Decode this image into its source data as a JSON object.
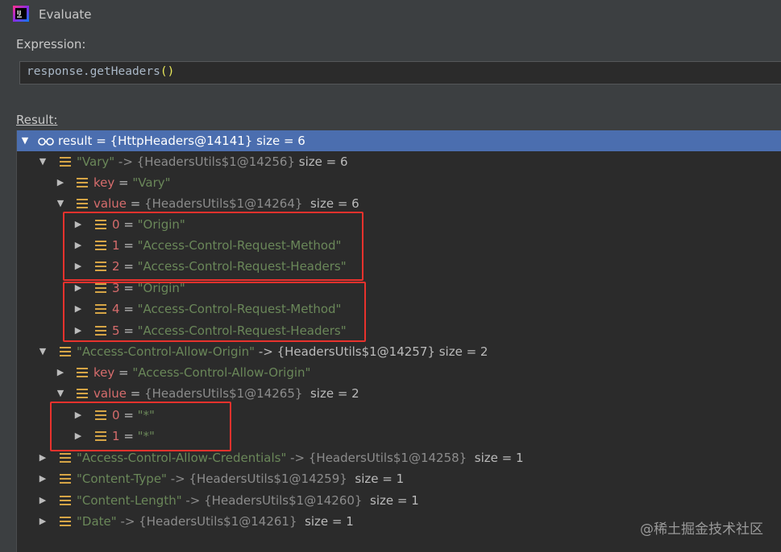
{
  "window": {
    "title": "Evaluate"
  },
  "expression": {
    "label": "Expression:",
    "code": "response.getHeaders",
    "parens": "()"
  },
  "result": {
    "label": "Result:"
  },
  "tree": [
    {
      "name": "root",
      "text": "result = {HttpHeaders@14141}  size = 6",
      "state": "expanded"
    },
    {
      "key": "\"Vary\"",
      "ref": "-> {HeadersUtils$1@14256}",
      "size": "size = 6",
      "state": "expanded"
    },
    {
      "label": "key",
      "eq": " = ",
      "val": "\"Vary\"",
      "state": "collapsed"
    },
    {
      "label": "value",
      "eq": " = ",
      "ref": "{HeadersUtils$1@14264}",
      "size": "size = 6",
      "state": "expanded"
    },
    {
      "idx": "0",
      "eq": " = ",
      "val": "\"Origin\"",
      "state": "collapsed"
    },
    {
      "idx": "1",
      "eq": " = ",
      "val": "\"Access-Control-Request-Method\"",
      "state": "collapsed"
    },
    {
      "idx": "2",
      "eq": " = ",
      "val": "\"Access-Control-Request-Headers\"",
      "state": "collapsed"
    },
    {
      "idx": "3",
      "eq": " = ",
      "val": "\"Origin\"",
      "state": "collapsed"
    },
    {
      "idx": "4",
      "eq": " = ",
      "val": "\"Access-Control-Request-Method\"",
      "state": "collapsed"
    },
    {
      "idx": "5",
      "eq": " = ",
      "val": "\"Access-Control-Request-Headers\"",
      "state": "collapsed"
    },
    {
      "key": "\"Access-Control-Allow-Origin\"",
      "ref": "-> {HeadersUtils$1@14257}",
      "size": "size = 2",
      "state": "expanded"
    },
    {
      "label": "key",
      "eq": " = ",
      "val": "\"Access-Control-Allow-Origin\"",
      "state": "collapsed"
    },
    {
      "label": "value",
      "eq": " = ",
      "ref": "{HeadersUtils$1@14265}",
      "size": "size = 2",
      "state": "expanded"
    },
    {
      "idx": "0",
      "eq": " = ",
      "val": "\"*\"",
      "state": "collapsed"
    },
    {
      "idx": "1",
      "eq": " = ",
      "val": "\"*\"",
      "state": "collapsed"
    },
    {
      "key": "\"Access-Control-Allow-Credentials\"",
      "ref": "-> {HeadersUtils$1@14258}",
      "size": "size = 1",
      "state": "collapsed"
    },
    {
      "key": "\"Content-Type\"",
      "ref": "-> {HeadersUtils$1@14259}",
      "size": "size = 1",
      "state": "collapsed"
    },
    {
      "key": "\"Content-Length\"",
      "ref": "-> {HeadersUtils$1@14260}",
      "size": "size = 1",
      "state": "collapsed"
    },
    {
      "key": "\"Date\"",
      "ref": "-> {HeadersUtils$1@14261}",
      "size": "size = 1",
      "state": "collapsed"
    }
  ],
  "watermark": "@稀土掘金技术社区",
  "colors": {
    "highlight_box": "#e8322d",
    "selection": "#4b6eaf",
    "string": "#6a8759",
    "field_icon": "#d6a546"
  }
}
